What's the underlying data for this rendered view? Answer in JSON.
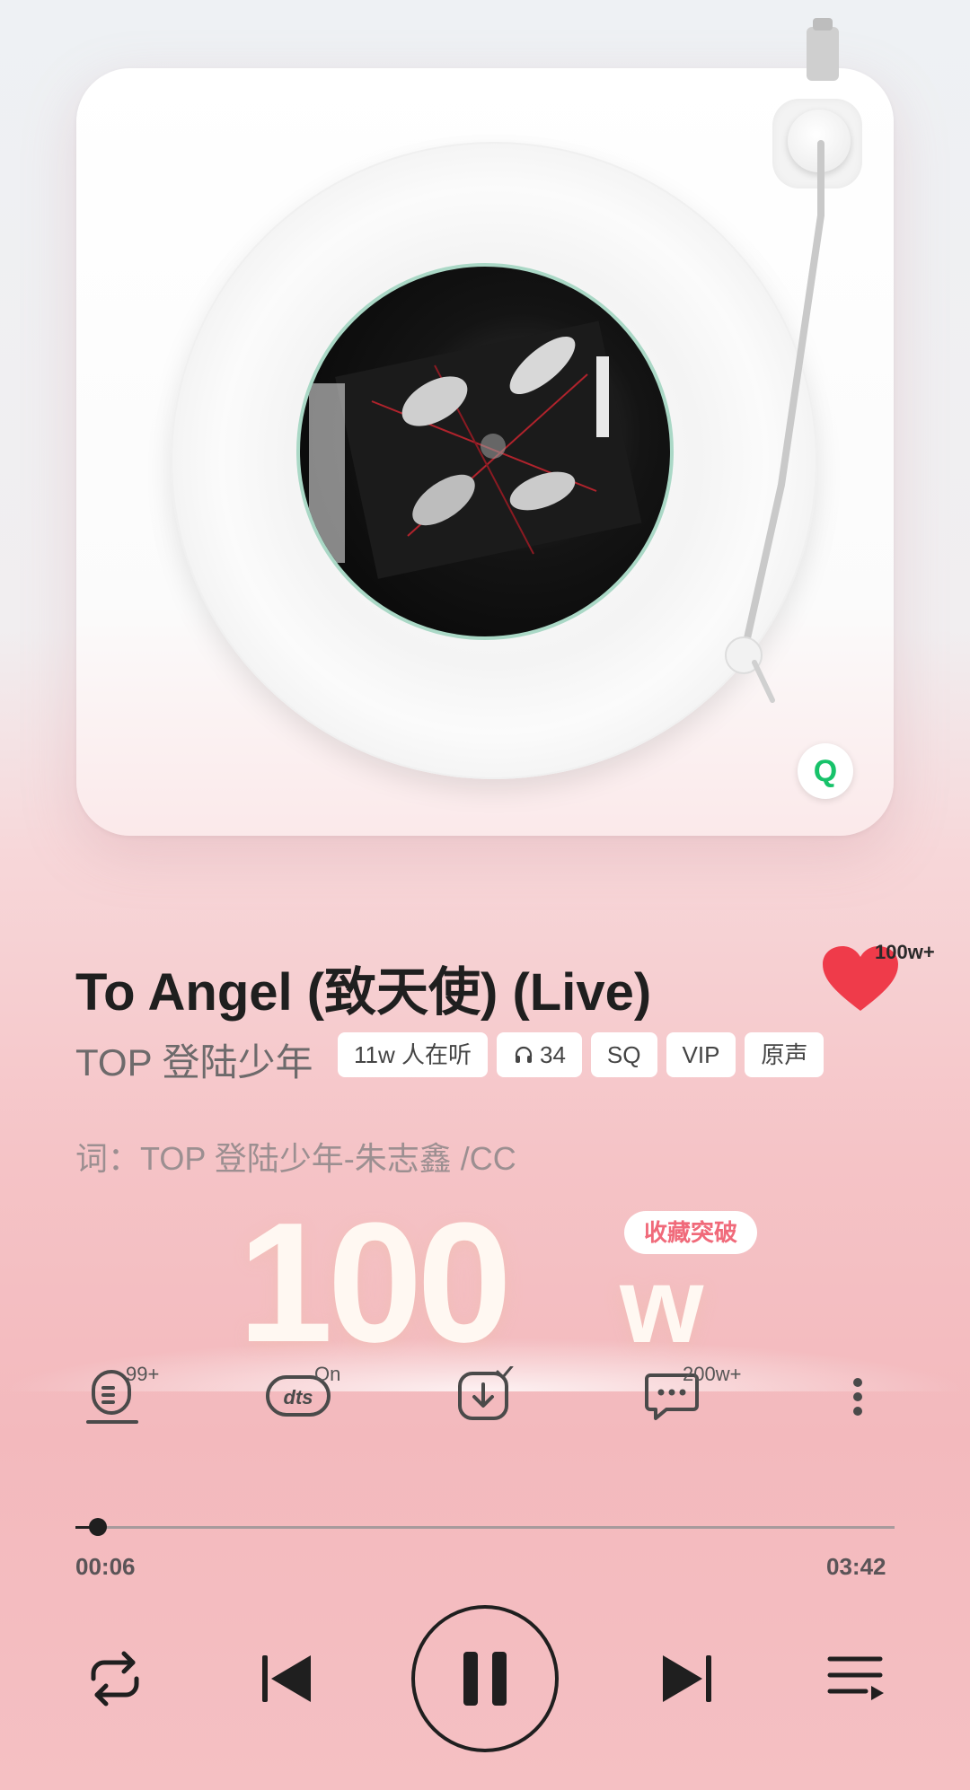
{
  "song": {
    "title": "To Angel (致天使) (Live)",
    "artist": "TOP 登陆少年",
    "lyricist": "词：TOP 登陆少年-朱志鑫 /CC",
    "like_count": "100w+",
    "tags": [
      "11w 人在听",
      "34",
      "SQ",
      "VIP",
      "原声"
    ]
  },
  "banner": {
    "number": "100",
    "unit": "w",
    "tag": "收藏突破"
  },
  "deck": {
    "badge": "Q"
  },
  "actions": {
    "lyrics_badge": "99+",
    "dts_badge": "On",
    "comments_badge": "200w+"
  },
  "progress": {
    "current": "00:06",
    "total": "03:42",
    "fraction": 0.027
  },
  "colors": {
    "accent_like": "#ef3b4a",
    "q_green": "#18c26a",
    "text_dark": "#1f1f1f"
  },
  "icons": {
    "repeat": "repeat-icon",
    "prev": "previous-icon",
    "pause": "pause-icon",
    "next": "next-icon",
    "playlist": "playlist-icon"
  }
}
